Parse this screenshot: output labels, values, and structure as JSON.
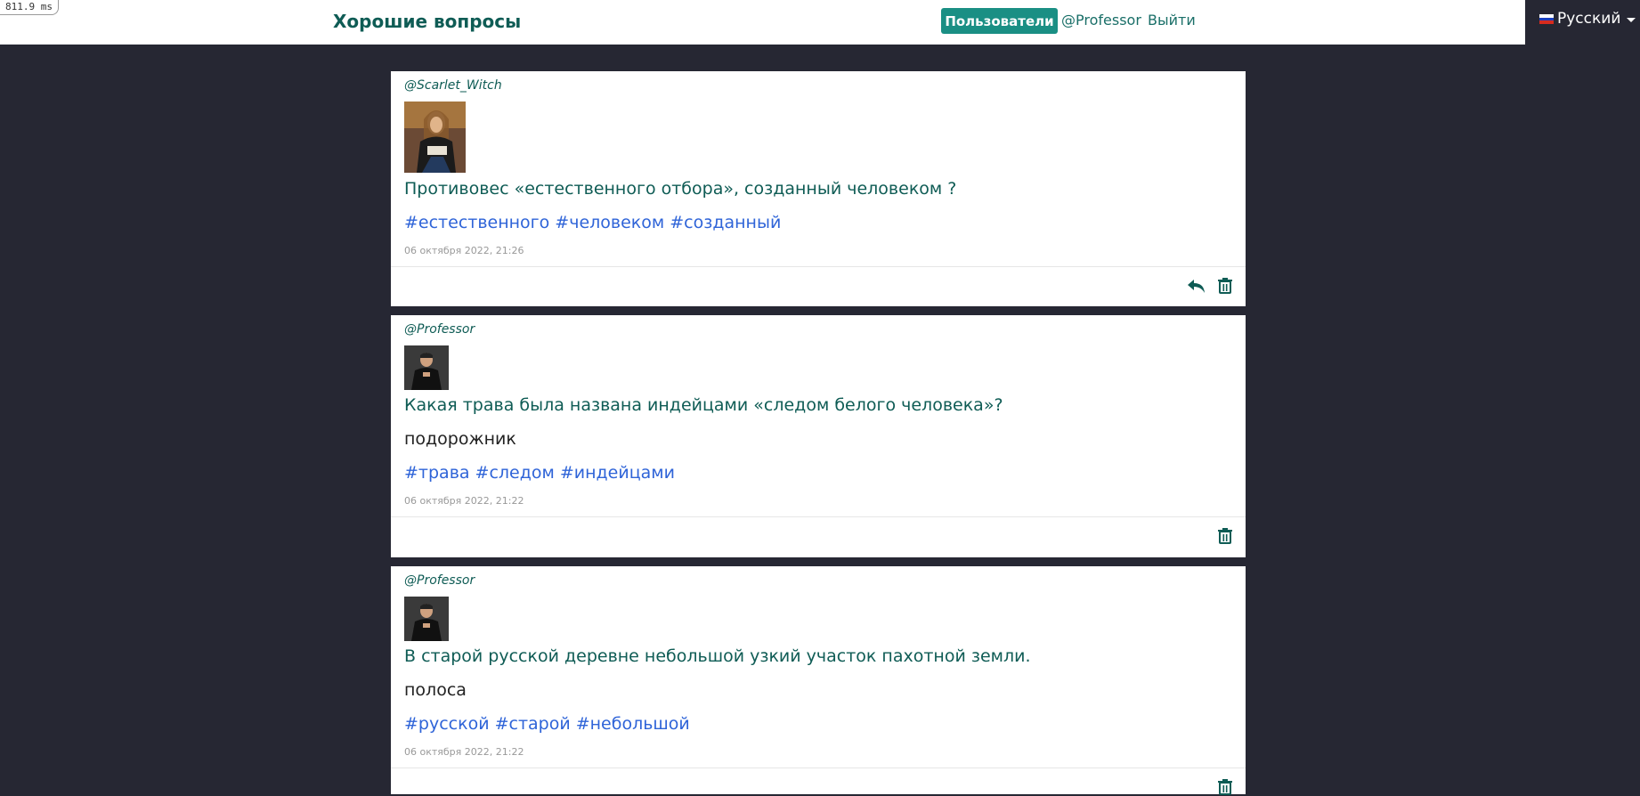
{
  "timer": "811.9 ms",
  "nav": {
    "brand": "Хорошие вопросы",
    "users_button": "Пользователи",
    "current_user": "@Professor",
    "logout": "Выйти",
    "language": "Русский"
  },
  "colors": {
    "accent": "#1a8f84",
    "brand_text": "#0f5c55",
    "tag": "#2f64d8",
    "background": "#262733"
  },
  "posts": [
    {
      "author": "@Scarlet_Witch",
      "question": "Противовес «естественного отбора», созданный человеком ?",
      "answer": "",
      "tags": [
        "#естественного",
        "#человеком",
        "#созданный"
      ],
      "date": "06 октября 2022, 21:26",
      "actions": [
        "reply-icon",
        "trash-icon"
      ]
    },
    {
      "author": "@Professor",
      "question": "Какая трава была названа индейцами «следом белого человека»?",
      "answer": "подорожник",
      "tags": [
        "#трава",
        "#следом",
        "#индейцами"
      ],
      "date": "06 октября 2022, 21:22",
      "actions": [
        "trash-icon"
      ]
    },
    {
      "author": "@Professor",
      "question": "В старой русской деревне небольшой узкий участок пахотной земли.",
      "answer": "полоса",
      "tags": [
        "#русской",
        "#старой",
        "#небольшой"
      ],
      "date": "06 октября 2022, 21:22",
      "actions": [
        "trash-icon"
      ]
    }
  ]
}
